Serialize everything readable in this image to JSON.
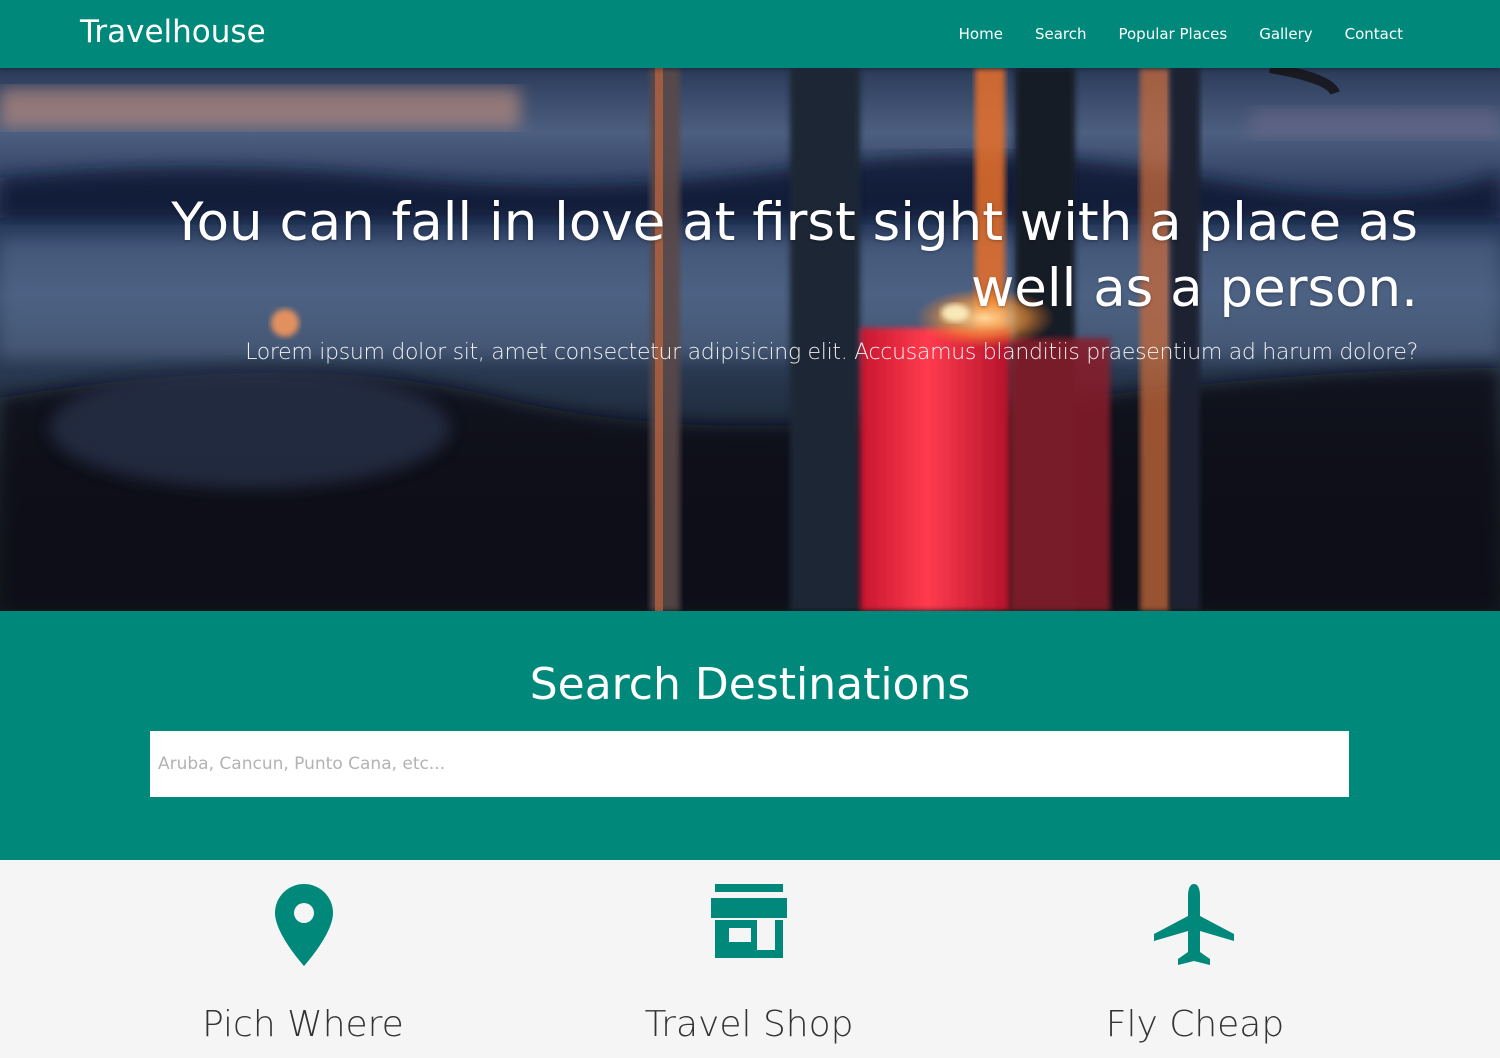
{
  "nav": {
    "brand": "Travelhouse",
    "links": [
      "Home",
      "Search",
      "Popular Places",
      "Gallery",
      "Contact"
    ]
  },
  "hero": {
    "title": "You can fall in love at first sight with a place as well as a person.",
    "subtitle": "Lorem ipsum dolor sit, amet consectetur adipisicing elit. Accusamus blanditiis praesentium ad harum dolore?"
  },
  "search": {
    "title": "Search Destinations",
    "placeholder": "Aruba, Cancun, Punto Cana, etc..."
  },
  "features": [
    {
      "icon": "location-pin-icon",
      "title": "Pich Where"
    },
    {
      "icon": "store-icon",
      "title": "Travel Shop"
    },
    {
      "icon": "airplane-icon",
      "title": "Fly Cheap"
    }
  ],
  "colors": {
    "primary": "#00897b",
    "section_bg": "#f5f5f5",
    "text": "#333333"
  }
}
